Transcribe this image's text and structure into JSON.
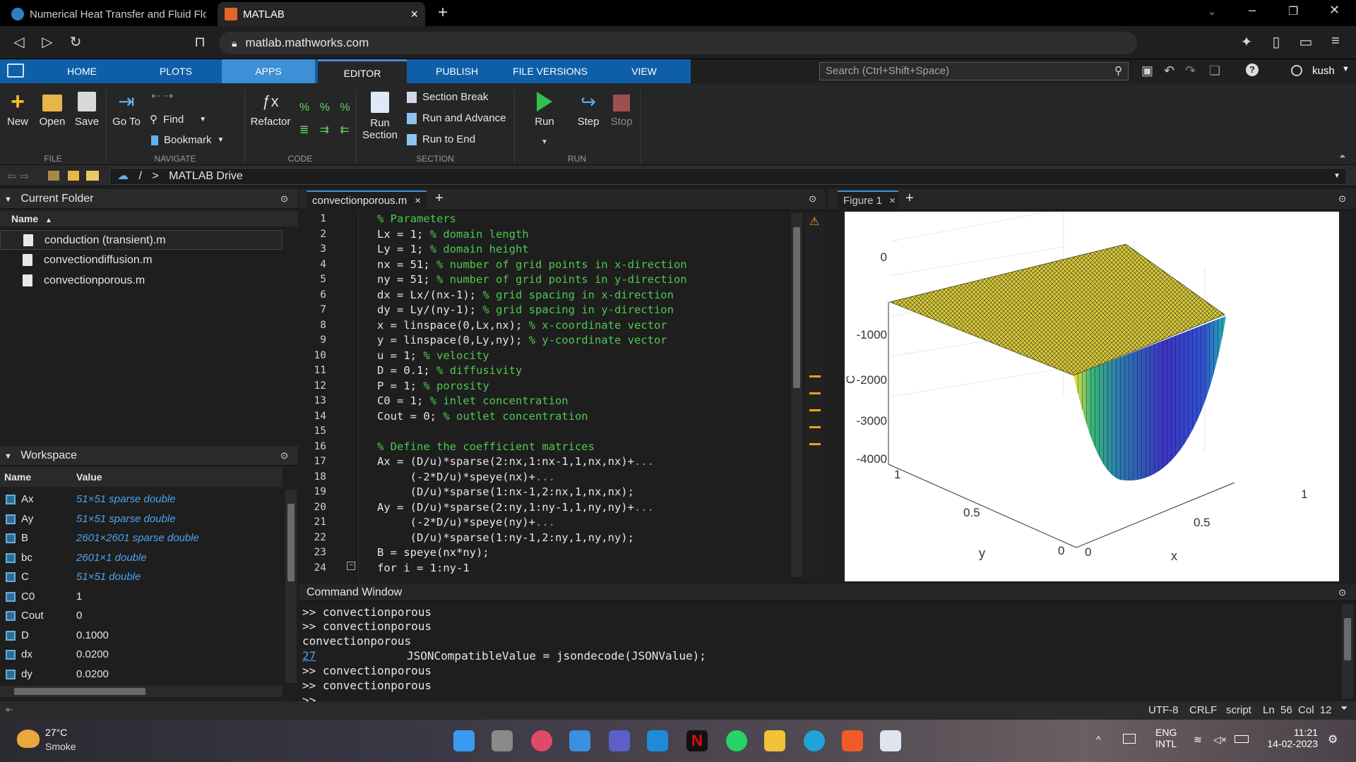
{
  "browser": {
    "tabs": [
      {
        "label": "Numerical Heat Transfer and Fluid Flo"
      },
      {
        "label": "MATLAB"
      }
    ],
    "new_tab": "+",
    "url": "matlab.mathworks.com"
  },
  "toolstrip": {
    "tabs": [
      "HOME",
      "PLOTS",
      "APPS",
      "EDITOR",
      "PUBLISH",
      "FILE VERSIONS",
      "VIEW"
    ],
    "active_tab": "EDITOR",
    "search_placeholder": "Search (Ctrl+Shift+Space)",
    "user": "kush",
    "file": {
      "new": "New",
      "open": "Open",
      "save": "Save",
      "label": "FILE"
    },
    "navigate": {
      "goto": "Go To",
      "find": "Find",
      "bookmark": "Bookmark",
      "label": "NAVIGATE"
    },
    "code": {
      "refactor": "Refactor",
      "label": "CODE"
    },
    "section": {
      "run_section_1": "Run",
      "run_section_2": "Section",
      "section_break": "Section Break",
      "run_advance": "Run and Advance",
      "run_end": "Run to End",
      "label": "SECTION"
    },
    "run": {
      "run": "Run",
      "step": "Step",
      "stop": "Stop",
      "label": "RUN"
    }
  },
  "path": {
    "slash": "/",
    "sep": ">",
    "current": "MATLAB Drive"
  },
  "current_folder": {
    "title": "Current Folder",
    "col_name": "Name",
    "files": [
      "conduction (transient).m",
      "convectiondiffusion.m",
      "convectionporous.m"
    ]
  },
  "workspace": {
    "title": "Workspace",
    "col_name": "Name",
    "col_value": "Value",
    "vars": [
      {
        "name": "Ax",
        "value": "51×51 sparse double",
        "link": true
      },
      {
        "name": "Ay",
        "value": "51×51 sparse double",
        "link": true
      },
      {
        "name": "B",
        "value": "2601×2601 sparse double",
        "link": true
      },
      {
        "name": "bc",
        "value": "2601×1 double",
        "link": true
      },
      {
        "name": "C",
        "value": "51×51 double",
        "link": true
      },
      {
        "name": "C0",
        "value": "1",
        "link": false
      },
      {
        "name": "Cout",
        "value": "0",
        "link": false
      },
      {
        "name": "D",
        "value": "0.1000",
        "link": false
      },
      {
        "name": "dx",
        "value": "0.0200",
        "link": false
      },
      {
        "name": "dy",
        "value": "0.0200",
        "link": false
      }
    ]
  },
  "editor": {
    "tab": "convectionporous.m",
    "lines": [
      {
        "n": "1",
        "code": "",
        "comment": "% Parameters"
      },
      {
        "n": "2",
        "code": "Lx = 1; ",
        "comment": "% domain length"
      },
      {
        "n": "3",
        "code": "Ly = 1; ",
        "comment": "% domain height"
      },
      {
        "n": "4",
        "code": "nx = 51; ",
        "comment": "% number of grid points in x-direction"
      },
      {
        "n": "5",
        "code": "ny = 51; ",
        "comment": "% number of grid points in y-direction"
      },
      {
        "n": "6",
        "code": "dx = Lx/(nx-1); ",
        "comment": "% grid spacing in x-direction"
      },
      {
        "n": "7",
        "code": "dy = Ly/(ny-1); ",
        "comment": "% grid spacing in y-direction"
      },
      {
        "n": "8",
        "code": "x = linspace(0,Lx,nx); ",
        "comment": "% x-coordinate vector"
      },
      {
        "n": "9",
        "code": "y = linspace(0,Ly,ny); ",
        "comment": "% y-coordinate vector"
      },
      {
        "n": "10",
        "code": "u = 1; ",
        "comment": "% velocity"
      },
      {
        "n": "11",
        "code": "D = 0.1; ",
        "comment": "% diffusivity"
      },
      {
        "n": "12",
        "code": "P = 1; ",
        "comment": "% porosity"
      },
      {
        "n": "13",
        "code": "C0 = 1; ",
        "comment": "% inlet concentration"
      },
      {
        "n": "14",
        "code": "Cout = 0; ",
        "comment": "% outlet concentration"
      },
      {
        "n": "15",
        "code": "",
        "comment": ""
      },
      {
        "n": "16",
        "code": "",
        "comment": "% Define the coefficient matrices"
      },
      {
        "n": "17",
        "code": "Ax = (D/u)*sparse(2:nx,1:nx-1,1,nx,nx)+",
        "comment": "..."
      },
      {
        "n": "18",
        "code": "     (-2*D/u)*speye(nx)+",
        "comment": "..."
      },
      {
        "n": "19",
        "code": "     (D/u)*sparse(1:nx-1,2:nx,1,nx,nx);",
        "comment": ""
      },
      {
        "n": "20",
        "code": "Ay = (D/u)*sparse(2:ny,1:ny-1,1,ny,ny)+",
        "comment": "..."
      },
      {
        "n": "21",
        "code": "     (-2*D/u)*speye(ny)+",
        "comment": "..."
      },
      {
        "n": "22",
        "code": "     (D/u)*sparse(1:ny-1,2:ny,1,ny,ny);",
        "comment": ""
      },
      {
        "n": "23",
        "code": "B = speye(nx*ny);",
        "comment": ""
      },
      {
        "n": "24",
        "code": "for i = 1:ny-1",
        "comment": ""
      }
    ]
  },
  "figure": {
    "tab": "Figure 1",
    "zlabel": "C",
    "xlabel": "x",
    "ylabel": "y",
    "zticks": [
      "0",
      "-1000",
      "-2000",
      "-3000",
      "-4000"
    ],
    "xticks": [
      "0",
      "0.5",
      "1"
    ],
    "yticks": [
      "0",
      "0.5",
      "1"
    ]
  },
  "command_window": {
    "title": "Command Window",
    "lines": [
      ">> convectionporous",
      ">> convectionporous",
      "convectionporous",
      "27",
      "JSONCompatibleValue = jsondecode(JSONValue);",
      ">> convectionporous",
      ">> convectionporous",
      ">>"
    ]
  },
  "status": {
    "encoding": "UTF-8",
    "eol": "CRLF",
    "type": "script",
    "pos": "Ln  56  Col  12"
  },
  "taskbar": {
    "temp": "27°C",
    "weather": "Smoke",
    "lang1": "ENG",
    "lang2": "INTL",
    "time": "11:21",
    "date": "14-02-2023"
  },
  "colors": {
    "accent": "#0f5fa8",
    "editor_bg": "#1e1e1e",
    "comment": "#4ec94e",
    "link": "#4aa3f0"
  }
}
